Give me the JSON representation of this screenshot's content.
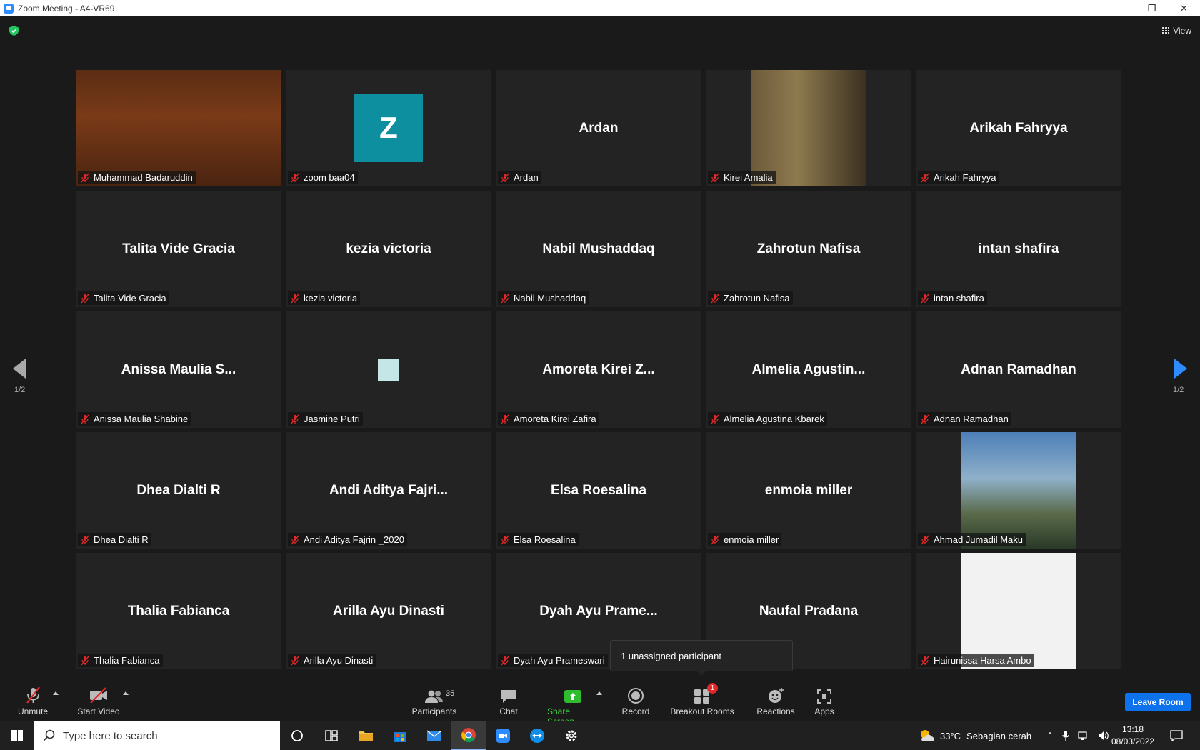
{
  "window": {
    "title": "Zoom Meeting - A4-VR69",
    "minimize_glyph": "—",
    "restore_glyph": "❐",
    "close_glyph": "✕"
  },
  "topbar": {
    "view_label": "View"
  },
  "pagination": {
    "left": "1/2",
    "right": "1/2"
  },
  "tiles": [
    {
      "label": "Muhammad Badaruddin",
      "center": "",
      "video": "photo-badaruddin",
      "active": true
    },
    {
      "label": "zoom baa04",
      "center": "",
      "avatar_letter": "Z"
    },
    {
      "label": "Ardan",
      "center": "Ardan"
    },
    {
      "label": "Kirei Amalia",
      "center": "",
      "video": "photo-kirei"
    },
    {
      "label": "Arikah Fahryya",
      "center": "Arikah Fahryya"
    },
    {
      "label": "Talita Vide Gracia",
      "center": "Talita Vide Gracia"
    },
    {
      "label": "kezia victoria",
      "center": "kezia victoria"
    },
    {
      "label": "Nabil Mushaddaq",
      "center": "Nabil Mushaddaq"
    },
    {
      "label": "Zahrotun Nafisa",
      "center": "Zahrotun Nafisa"
    },
    {
      "label": "intan shafira",
      "center": "intan shafira"
    },
    {
      "label": "Anissa Maulia Shabine",
      "center": "Anissa  Maulia  S..."
    },
    {
      "label": "Jasmine Putri",
      "center": "",
      "tiny_avatar": true
    },
    {
      "label": "Amoreta Kirei Zafira",
      "center": "Amoreta  Kirei  Z..."
    },
    {
      "label": "Almelia Agustina Kbarek",
      "center": "Almelia  Agustin..."
    },
    {
      "label": "Adnan Ramadhan",
      "center": "Adnan Ramadhan"
    },
    {
      "label": "Dhea Dialti R",
      "center": "Dhea Dialti R"
    },
    {
      "label": "Andi Aditya Fajrin _2020",
      "center": "Andi  Aditya  Fajri..."
    },
    {
      "label": "Elsa Roesalina",
      "center": "Elsa Roesalina"
    },
    {
      "label": "enmoia miller",
      "center": "enmoia miller"
    },
    {
      "label": "Ahmad Jumadil Maku",
      "center": "",
      "video": "photo-ahmad"
    },
    {
      "label": "Thalia Fabianca",
      "center": "Thalia Fabianca"
    },
    {
      "label": "Arilla Ayu Dinasti",
      "center": "Arilla Ayu Dinasti"
    },
    {
      "label": "Dyah Ayu Prameswari",
      "center": "Dyah  Ayu  Prame..."
    },
    {
      "label": "",
      "center": "Naufal Pradana",
      "hide_label": true
    },
    {
      "label": "Hairunissa Harsa Ambo",
      "center": "",
      "video": "photo-hairunissa"
    }
  ],
  "tooltip": {
    "text": "1 unassigned participant"
  },
  "toolbar": {
    "unmute": "Unmute",
    "start_video": "Start Video",
    "participants": "Participants",
    "participants_count": "35",
    "chat": "Chat",
    "share_screen": "Share Screen",
    "record": "Record",
    "breakout_rooms": "Breakout Rooms",
    "breakout_badge": "1",
    "reactions": "Reactions",
    "apps": "Apps",
    "leave_room": "Leave Room"
  },
  "colors": {
    "active_speaker": "#d8e94c",
    "share_green": "#3ece3e",
    "leave_blue": "#0e72ed",
    "mute_red": "#e02828"
  },
  "taskbar": {
    "search_placeholder": "Type here to search",
    "weather_temp": "33°C",
    "weather_desc": "Sebagian cerah",
    "time": "13:18",
    "date": "08/03/2022"
  }
}
